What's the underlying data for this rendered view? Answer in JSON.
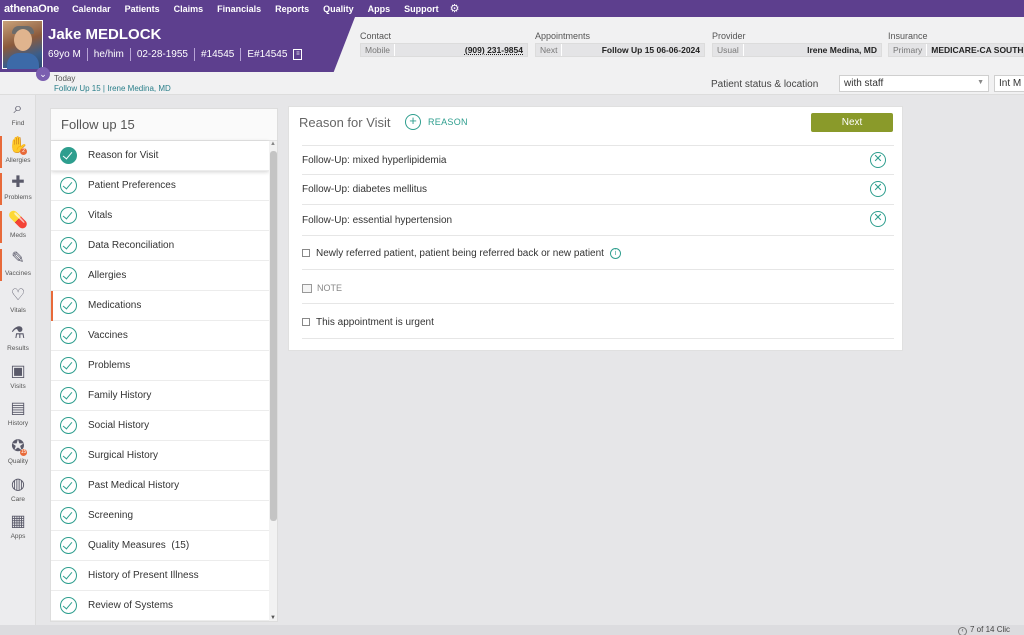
{
  "nav": {
    "logo": "athenaOne",
    "items": [
      "Calendar",
      "Patients",
      "Claims",
      "Financials",
      "Reports",
      "Quality",
      "Apps",
      "Support"
    ],
    "gear_icon": "gear-icon"
  },
  "patient": {
    "name": "Jake MEDLOCK",
    "age_sex": "69yo M",
    "pronouns": "he/him",
    "dob": "02-28-1955",
    "id1": "#14545",
    "id2": "E#14545"
  },
  "contact": {
    "title": "Contact",
    "key": "Mobile",
    "value": "(909) 231-9854"
  },
  "appointments": {
    "title": "Appointments",
    "key": "Next",
    "value": "Follow Up 15 06-06-2024"
  },
  "provider": {
    "title": "Provider",
    "key": "Usual",
    "value": "Irene Medina, MD"
  },
  "insurance": {
    "title": "Insurance",
    "key": "Primary",
    "value": "MEDICARE-CA SOUTHERN"
  },
  "today": {
    "label": "Today",
    "visit": "Follow Up 15 | Irene Medina, MD",
    "status_label": "Patient status & location",
    "status_value": "with staff",
    "location_value": "Int M"
  },
  "rail": [
    {
      "label": "Find",
      "icon": "search-icon",
      "glyph": "⌕"
    },
    {
      "label": "Allergies",
      "icon": "hand-icon",
      "glyph": "✋",
      "badge": "2"
    },
    {
      "label": "Problems",
      "icon": "bandage-icon",
      "glyph": "✚"
    },
    {
      "label": "Meds",
      "icon": "pill-icon",
      "glyph": "💊"
    },
    {
      "label": "Vaccines",
      "icon": "syringe-icon",
      "glyph": "✎"
    },
    {
      "label": "Vitals",
      "icon": "heartbeat-icon",
      "glyph": "♡"
    },
    {
      "label": "Results",
      "icon": "flask-icon",
      "glyph": "⚗"
    },
    {
      "label": "Visits",
      "icon": "briefcase-icon",
      "glyph": "▣"
    },
    {
      "label": "History",
      "icon": "clipboard-icon",
      "glyph": "▤"
    },
    {
      "label": "Quality",
      "icon": "ribbon-icon",
      "glyph": "✪",
      "badge": "15"
    },
    {
      "label": "Care",
      "icon": "care-icon",
      "glyph": "◍"
    },
    {
      "label": "Apps",
      "icon": "apps-grid-icon",
      "glyph": "▦"
    }
  ],
  "checklist": {
    "title": "Follow up 15",
    "items": [
      "Reason for Visit",
      "Patient Preferences",
      "Vitals",
      "Data Reconciliation",
      "Allergies",
      "Medications",
      "Vaccines",
      "Problems",
      "Family History",
      "Social History",
      "Surgical History",
      "Past Medical History",
      "Screening",
      "Quality Measures  (15)",
      "History of Present Illness",
      "Review of Systems"
    ]
  },
  "reason": {
    "title": "Reason for Visit",
    "add_label": "REASON",
    "next_label": "Next",
    "rows": [
      "Follow-Up: mixed hyperlipidemia",
      "Follow-Up: diabetes mellitus",
      "Follow-Up: essential hypertension"
    ],
    "new_patient_label": "Newly referred patient, patient being referred back or new patient",
    "note_label": "NOTE",
    "urgent_label": "This appointment is urgent"
  },
  "footer": {
    "page": "7 of 14 Clic"
  }
}
